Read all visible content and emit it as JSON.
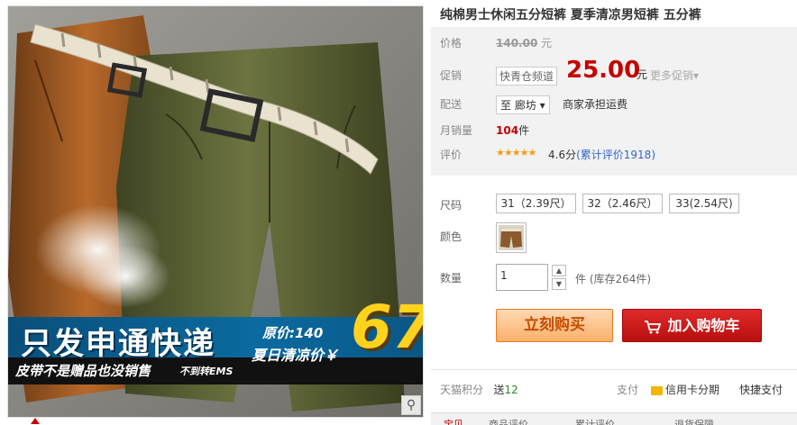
{
  "product": {
    "title": "纯棉男士休闲五分短裤 夏季清凉男短裤 五分裤"
  },
  "banner": {
    "title": "只发申通快递",
    "original_price": "原价:140",
    "sub": "夏日清凉价￥",
    "big_price": "67",
    "left_line": "皮带不是赠品也没销售",
    "left_line2": "不到转EMS"
  },
  "labels": {
    "price": "价格",
    "promo": "促销",
    "shipping": "配送",
    "monthly_sales": "月销量",
    "rating": "评价",
    "size": "尺码",
    "color": "颜色",
    "quantity": "数量"
  },
  "price": {
    "original": "140.00",
    "original_unit": "元",
    "promo_tag": "快青仓频道",
    "current": "25.00",
    "current_unit": "元",
    "more_promo": "更多促销▾"
  },
  "shipping": {
    "destination": "至 廊坊 ▾",
    "note": "商家承担运费"
  },
  "sales": {
    "count": "104",
    "unit": "件"
  },
  "rating": {
    "stars": "★★★★★",
    "score": "4.6分",
    "reviews_prefix": "(累计评价",
    "reviews_count": "1918",
    "reviews_suffix": ")",
    "stars_value": 4.6
  },
  "sizes": [
    {
      "label": "31（2.39尺）"
    },
    {
      "label": "32（2.46尺）"
    },
    {
      "label": "33(2.54尺)"
    }
  ],
  "quantity": {
    "value": "1",
    "up": "▲",
    "down": "▼",
    "stock": "件 (库存264件)"
  },
  "actions": {
    "buy": "立刻购买",
    "cart": "加入购物车"
  },
  "footer": {
    "points_label": "天猫积分",
    "points_prefix": "送",
    "points_value": "12",
    "pay_label": "支付",
    "credit_installment": "信用卡分期",
    "quick_pay": "快捷支付"
  },
  "tabs": [
    "宝贝",
    "商品评价",
    "累计评价",
    "退货保障"
  ],
  "zoom_icon": "⚲",
  "colors": {
    "price_red": "#c40000",
    "cart_red": "#c81010",
    "buy_orange": "#fbb06a",
    "banner_blue": "#0b6a9f",
    "banner_yellow": "#ffd21c"
  }
}
